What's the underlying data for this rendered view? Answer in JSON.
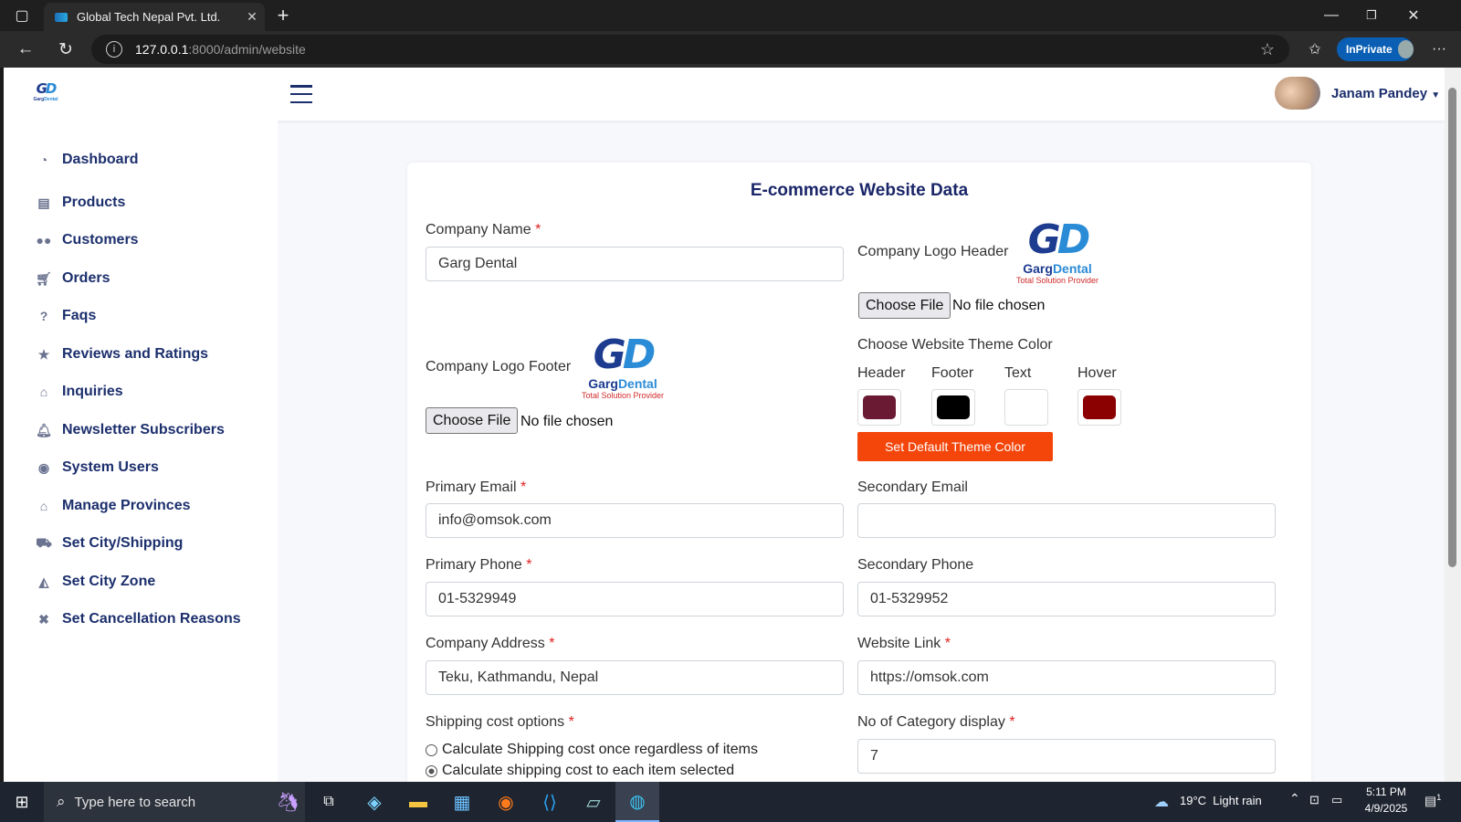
{
  "browser": {
    "tab_title": "Global Tech Nepal Pvt. Ltd.",
    "url_host": "127.0.0.1",
    "url_path": ":8000/admin/website",
    "inprivate_label": "InPrivate"
  },
  "topnav": {
    "user_name": "Janam Pandey"
  },
  "sidebar": {
    "items": [
      {
        "label": "Dashboard",
        "icon": "dashboard-icon"
      },
      {
        "label": "Products",
        "icon": "list-icon"
      },
      {
        "label": "Customers",
        "icon": "users-icon"
      },
      {
        "label": "Orders",
        "icon": "cart-icon"
      },
      {
        "label": "Faqs",
        "icon": "question-icon"
      },
      {
        "label": "Reviews and Ratings",
        "icon": "star-icon"
      },
      {
        "label": "Inquiries",
        "icon": "inbox-icon"
      },
      {
        "label": "Newsletter Subscribers",
        "icon": "bell-icon"
      },
      {
        "label": "System Users",
        "icon": "user-circle-icon"
      },
      {
        "label": "Manage Provinces",
        "icon": "inbox-icon"
      },
      {
        "label": "Set City/Shipping",
        "icon": "truck-icon"
      },
      {
        "label": "Set City Zone",
        "icon": "area-chart-icon"
      },
      {
        "label": "Set Cancellation Reasons",
        "icon": "close-icon"
      }
    ]
  },
  "form": {
    "title": "E-commerce Website Data",
    "company_name_label": "Company Name",
    "company_name_value": "Garg Dental",
    "logo_header_label": "Company Logo Header",
    "logo_footer_label": "Company Logo Footer",
    "choose_file_label": "Choose File",
    "no_file_text": "No file chosen",
    "logo": {
      "mark_left": "G",
      "mark_right": "D",
      "brand_a": "Garg",
      "brand_b": "Dental",
      "tagline": "Total Solution Provider"
    },
    "theme_label": "Choose Website Theme Color",
    "theme_colors": [
      {
        "label": "Header",
        "color": "#6b1a33"
      },
      {
        "label": "Footer",
        "color": "#000000"
      },
      {
        "label": "Text",
        "color": "#ffffff"
      },
      {
        "label": "Hover",
        "color": "#8b0000"
      }
    ],
    "default_theme_button": "Set Default Theme Color",
    "primary_email_label": "Primary Email",
    "primary_email_value": "info@omsok.com",
    "secondary_email_label": "Secondary Email",
    "secondary_email_value": "",
    "primary_phone_label": "Primary Phone",
    "primary_phone_value": "01-5329949",
    "secondary_phone_label": "Secondary Phone",
    "secondary_phone_value": "01-5329952",
    "address_label": "Company Address",
    "address_value": "Teku, Kathmandu, Nepal",
    "website_label": "Website Link",
    "website_value": "https://omsok.com",
    "shipping_label": "Shipping cost options",
    "shipping_options": [
      {
        "label": "Calculate Shipping cost once regardless of items",
        "selected": false
      },
      {
        "label": "Calculate shipping cost to each item selected",
        "selected": true
      }
    ],
    "category_label": "No of Category display",
    "category_value": "7",
    "required_mark": "*"
  },
  "taskbar": {
    "search_placeholder": "Type here to search",
    "weather": "19°C  Light rain",
    "time": "5:11 PM",
    "date": "4/9/2025",
    "notification_count": "1"
  }
}
